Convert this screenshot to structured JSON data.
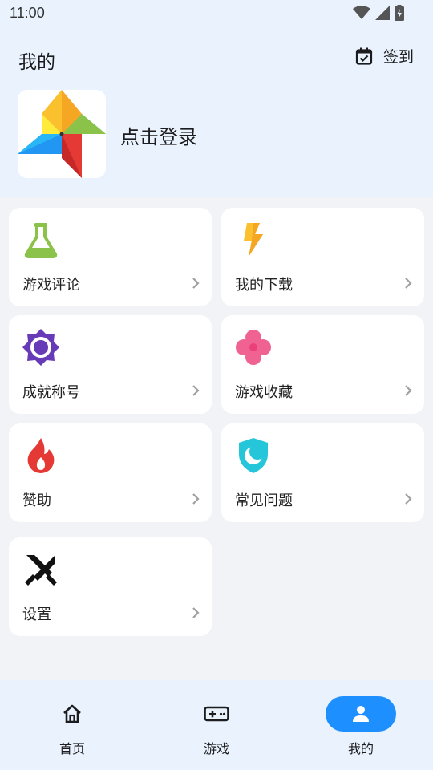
{
  "status_bar": {
    "time": "11:00"
  },
  "header": {
    "title": "我的",
    "checkin_label": "签到"
  },
  "profile": {
    "login_label": "点击登录"
  },
  "menu": [
    {
      "label": "游戏评论",
      "icon": "flask-icon"
    },
    {
      "label": "我的下载",
      "icon": "lightning-icon"
    },
    {
      "label": "成就称号",
      "icon": "sun-badge-icon"
    },
    {
      "label": "游戏收藏",
      "icon": "clover-icon"
    },
    {
      "label": "赞助",
      "icon": "flame-icon"
    },
    {
      "label": "常见问题",
      "icon": "shield-moon-icon"
    },
    {
      "label": "设置",
      "icon": "crossed-swords-icon"
    }
  ],
  "bottom_nav": [
    {
      "label": "首页",
      "icon": "home-icon"
    },
    {
      "label": "游戏",
      "icon": "gamepad-icon"
    },
    {
      "label": "我的",
      "icon": "person-icon",
      "active": true
    }
  ],
  "colors": {
    "accent": "#1e8fff",
    "top_background": "#eaf3fd",
    "page_background": "#f1f3f6"
  }
}
